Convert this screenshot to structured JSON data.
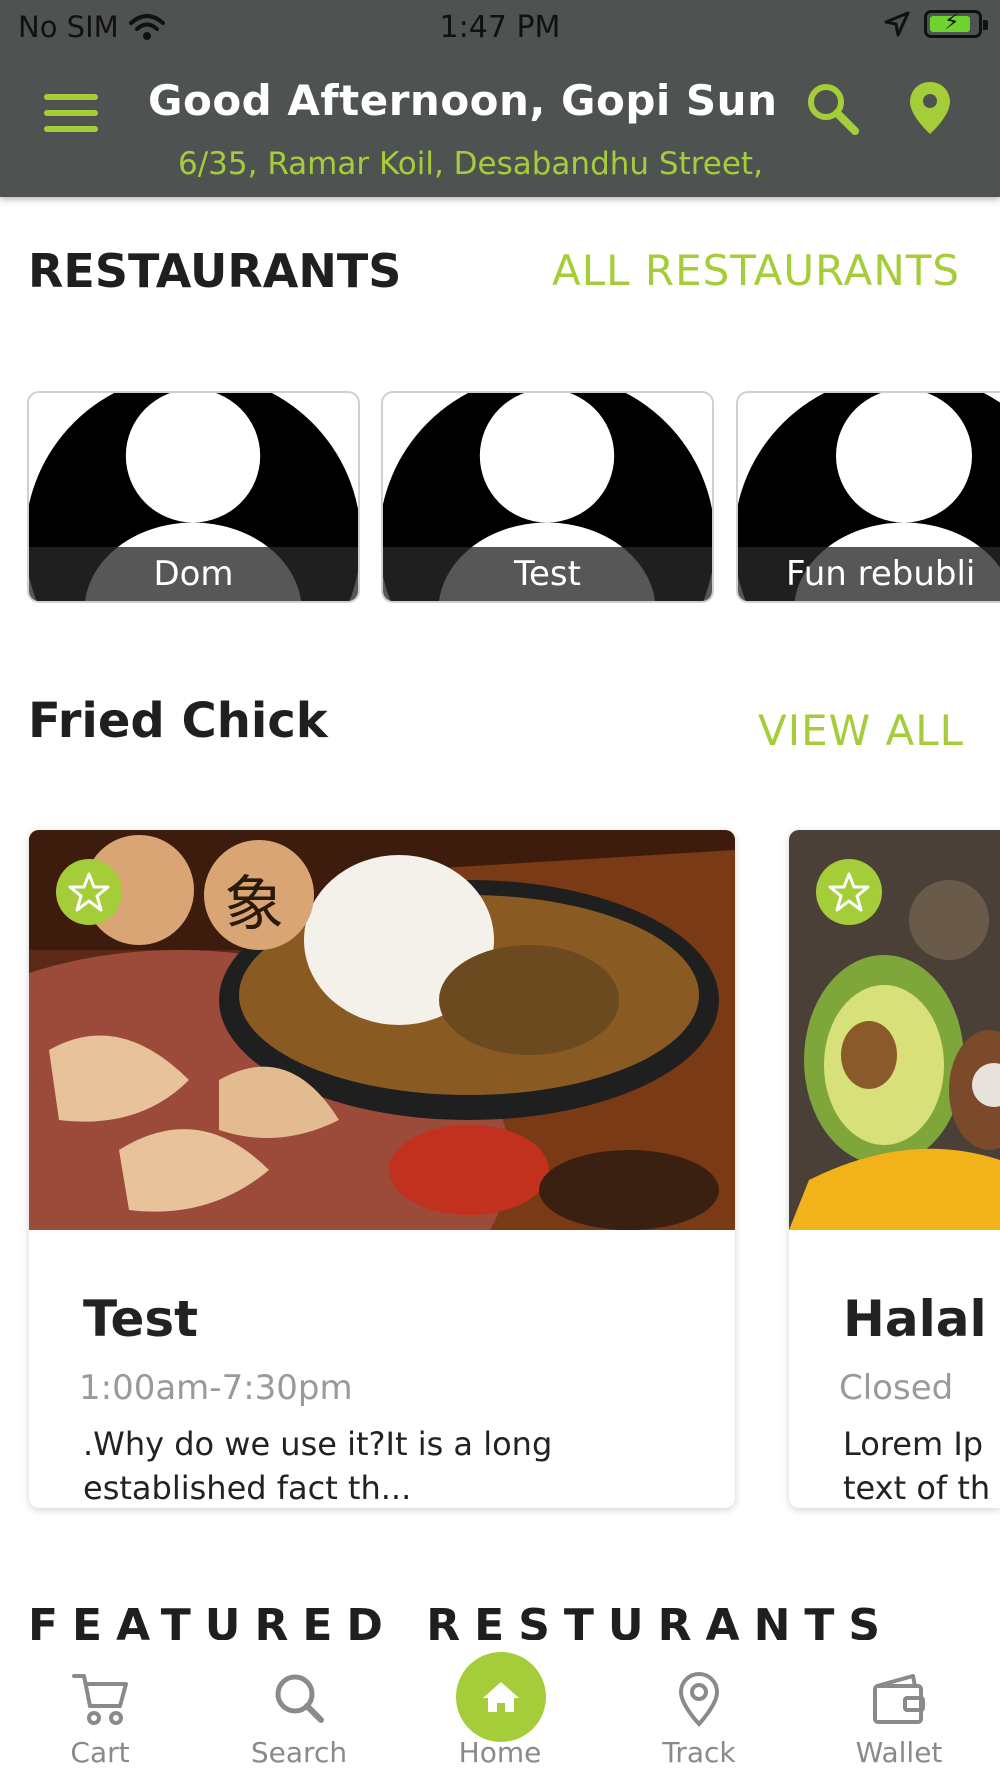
{
  "status_bar": {
    "carrier": "No SIM",
    "time": "1:47 PM"
  },
  "header": {
    "greeting": "Good Afternoon, Gopi Sun...",
    "address": "6/35, Ramar Koil, Desabandhu Street,"
  },
  "restaurants_section": {
    "title": "RESTAURANTS",
    "link": "ALL RESTAURANTS",
    "items": [
      {
        "name": "Dom"
      },
      {
        "name": "Test"
      },
      {
        "name": "Fun rebubli"
      }
    ]
  },
  "category_section": {
    "title": "Fried Chick",
    "link": "VIEW ALL",
    "cards": [
      {
        "name": "Test",
        "hours": "1:00am-7:30pm",
        "description": ".Why do we use it?It is a long established fact th..."
      },
      {
        "name": "Halal I",
        "hours": "Closed",
        "description": "Lorem Ip text of th"
      }
    ]
  },
  "featured_section": {
    "title": "FEATURED RESTURANTS"
  },
  "tab_bar": {
    "items": [
      {
        "label": "Cart",
        "icon": "cart-icon"
      },
      {
        "label": "Search",
        "icon": "search-icon"
      },
      {
        "label": "Home",
        "icon": "home-icon"
      },
      {
        "label": "Track",
        "icon": "location-pin-icon"
      },
      {
        "label": "Wallet",
        "icon": "wallet-icon"
      }
    ]
  },
  "colors": {
    "accent": "#a5cd39",
    "header_bg": "#4e5251",
    "tab_inactive": "#8a8a8a"
  }
}
